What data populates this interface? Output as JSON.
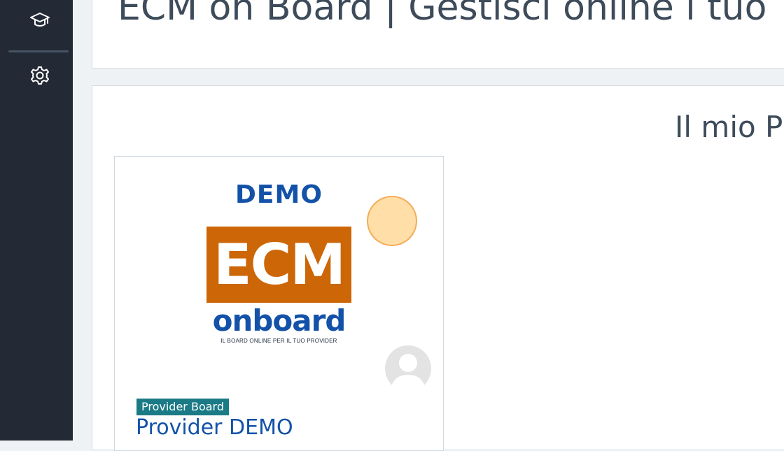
{
  "sidebar": {
    "items": [
      {
        "icon": "graduation-cap-icon"
      },
      {
        "icon": "gear-icon"
      }
    ]
  },
  "header": {
    "title": "ECM on Board | Gestisci online i tuo"
  },
  "main": {
    "section_title": "Il mio P",
    "course": {
      "logo_demo": "DEMO",
      "logo_ecm": "ECM",
      "logo_onboard": "onboard",
      "logo_tagline": "IL BOARD ONLINE PER IL TUO PROVIDER",
      "category": "Provider Board",
      "name": "Provider DEMO"
    }
  },
  "colors": {
    "sidebar_bg": "#242a35",
    "logo_blue": "#1352a8",
    "logo_orange": "#cd6606",
    "badge_teal": "#1a7a86"
  }
}
